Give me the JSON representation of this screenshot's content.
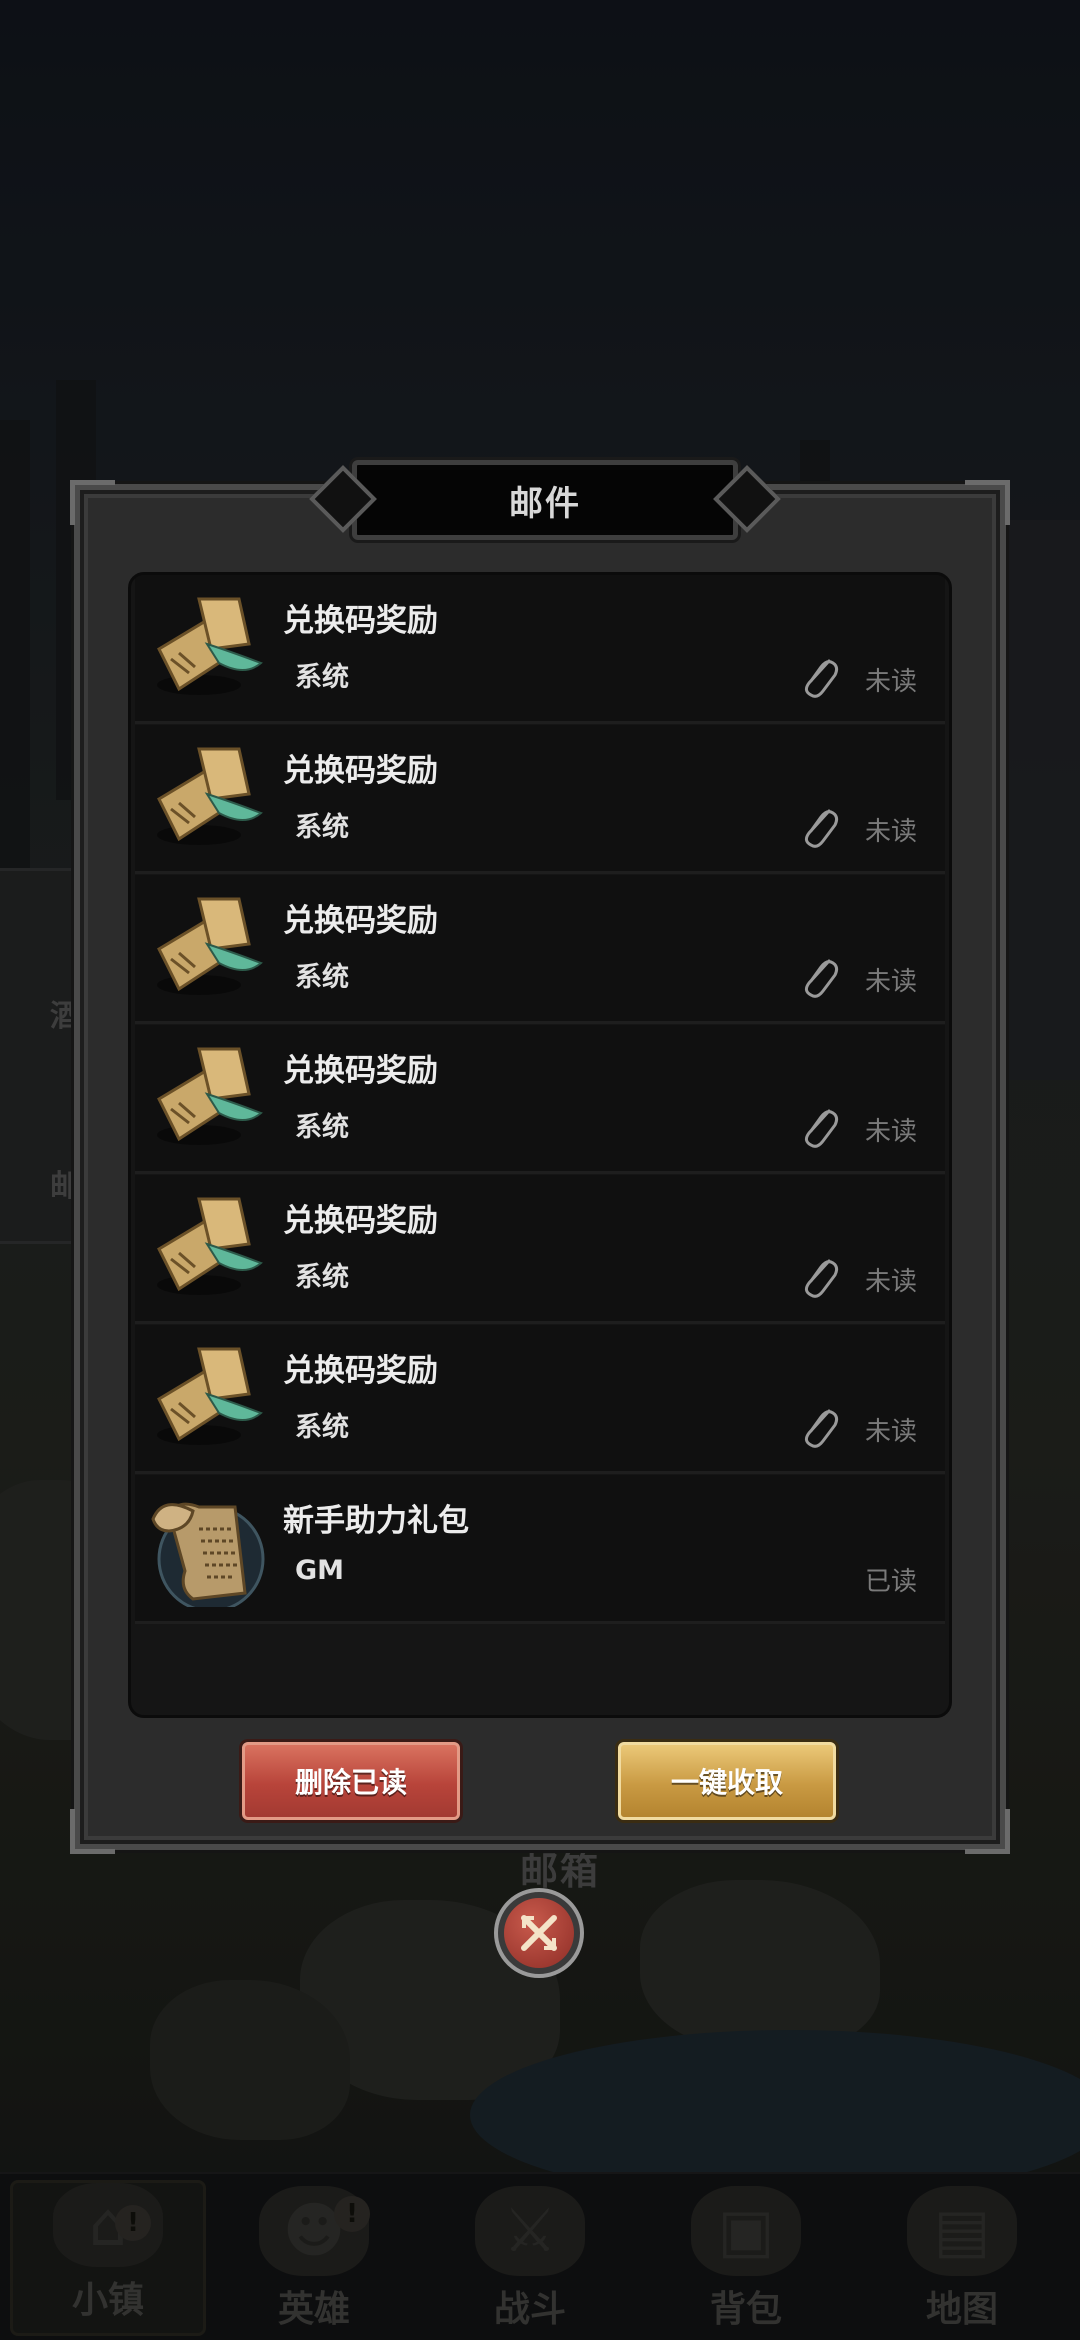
{
  "dialog": {
    "title": "邮件",
    "mails": [
      {
        "title": "兑换码奖励",
        "sender": "系统",
        "has_attachment": true,
        "status": "未读",
        "icon": "scroll-bundle-icon"
      },
      {
        "title": "兑换码奖励",
        "sender": "系统",
        "has_attachment": true,
        "status": "未读",
        "icon": "scroll-bundle-icon"
      },
      {
        "title": "兑换码奖励",
        "sender": "系统",
        "has_attachment": true,
        "status": "未读",
        "icon": "scroll-bundle-icon"
      },
      {
        "title": "兑换码奖励",
        "sender": "系统",
        "has_attachment": true,
        "status": "未读",
        "icon": "scroll-bundle-icon"
      },
      {
        "title": "兑换码奖励",
        "sender": "系统",
        "has_attachment": true,
        "status": "未读",
        "icon": "scroll-bundle-icon"
      },
      {
        "title": "兑换码奖励",
        "sender": "系统",
        "has_attachment": true,
        "status": "未读",
        "icon": "scroll-bundle-icon"
      },
      {
        "title": "新手助力礼包",
        "sender": "GM",
        "has_attachment": false,
        "status": "已读",
        "icon": "parchment-scroll-icon"
      }
    ],
    "delete_read_label": "删除已读",
    "collect_all_label": "一键收取"
  },
  "background": {
    "side_panel_labels": [
      "酒",
      "邮"
    ],
    "behind_label": "邮箱"
  },
  "tabbar": {
    "tabs": [
      {
        "label": "小镇",
        "icon": "town-icon",
        "badge": "!"
      },
      {
        "label": "英雄",
        "icon": "hero-icon",
        "badge": "!"
      },
      {
        "label": "战斗",
        "icon": "crossed-swords-icon",
        "badge": ""
      },
      {
        "label": "背包",
        "icon": "backpack-icon",
        "badge": ""
      },
      {
        "label": "地图",
        "icon": "map-icon",
        "badge": ""
      }
    ]
  },
  "colors": {
    "delete_button": "#b8443a",
    "collect_button": "#c99a43",
    "unread_text": "#7a7a7a"
  }
}
